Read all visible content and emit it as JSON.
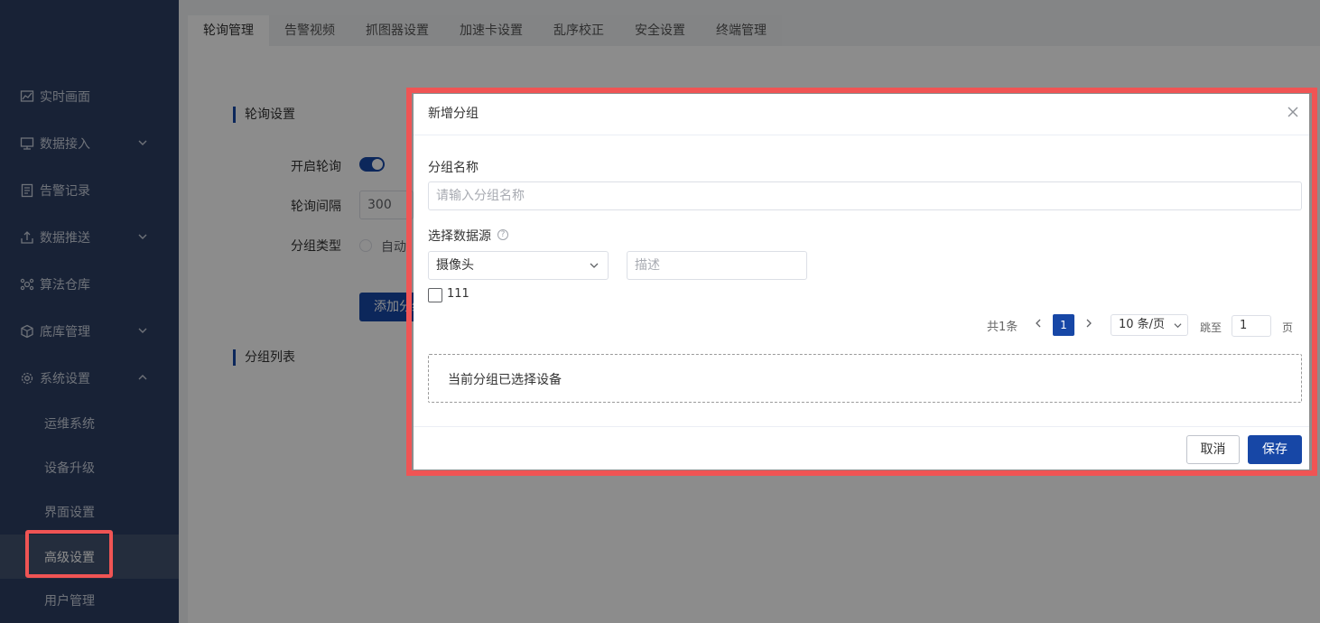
{
  "sidebar": {
    "items": [
      {
        "label": "实时画面",
        "icon": "chart-line-icon"
      },
      {
        "label": "数据接入",
        "icon": "monitor-icon"
      },
      {
        "label": "告警记录",
        "icon": "document-icon"
      },
      {
        "label": "数据推送",
        "icon": "upload-icon"
      },
      {
        "label": "算法仓库",
        "icon": "algorithm-icon"
      },
      {
        "label": "底库管理",
        "icon": "cube-icon"
      },
      {
        "label": "系统设置",
        "icon": "gear-icon"
      }
    ],
    "sub_items": [
      {
        "label": "运维系统"
      },
      {
        "label": "设备升级"
      },
      {
        "label": "界面设置"
      },
      {
        "label": "高级设置"
      },
      {
        "label": "用户管理"
      }
    ],
    "active_item": "高级设置"
  },
  "tabs": [
    {
      "label": "轮询管理"
    },
    {
      "label": "告警视频"
    },
    {
      "label": "抓图器设置"
    },
    {
      "label": "加速卡设置"
    },
    {
      "label": "乱序校正"
    },
    {
      "label": "安全设置"
    },
    {
      "label": "终端管理"
    }
  ],
  "active_tab": "轮询管理",
  "background": {
    "section_poll": "轮询设置",
    "enable_poll_label": "开启轮询",
    "enable_poll_on": true,
    "interval_label": "轮询间隔",
    "interval_value": "300",
    "group_type_label": "分组类型",
    "group_type_option": "自动",
    "add_button": "添加分组",
    "section_list": "分组列表"
  },
  "dialog": {
    "title": "新增分组",
    "group_name_label": "分组名称",
    "group_name_placeholder": "请输入分组名称",
    "source_label": "选择数据源",
    "source_help": "?",
    "source_select": "摄像头",
    "desc_placeholder": "描述",
    "device_checkbox_label": "111",
    "pagination": {
      "total": "共1条",
      "current_page": "1",
      "page_size": "10 条/页",
      "goto_label": "跳至",
      "goto_value": "1",
      "page_suffix": "页"
    },
    "selected_devices_label": "当前分组已选择设备",
    "cancel_button": "取消",
    "save_button": "保存"
  },
  "colors": {
    "sidebar_bg": "#2d3e63",
    "primary": "#1747a6",
    "highlight": "#f05454"
  }
}
